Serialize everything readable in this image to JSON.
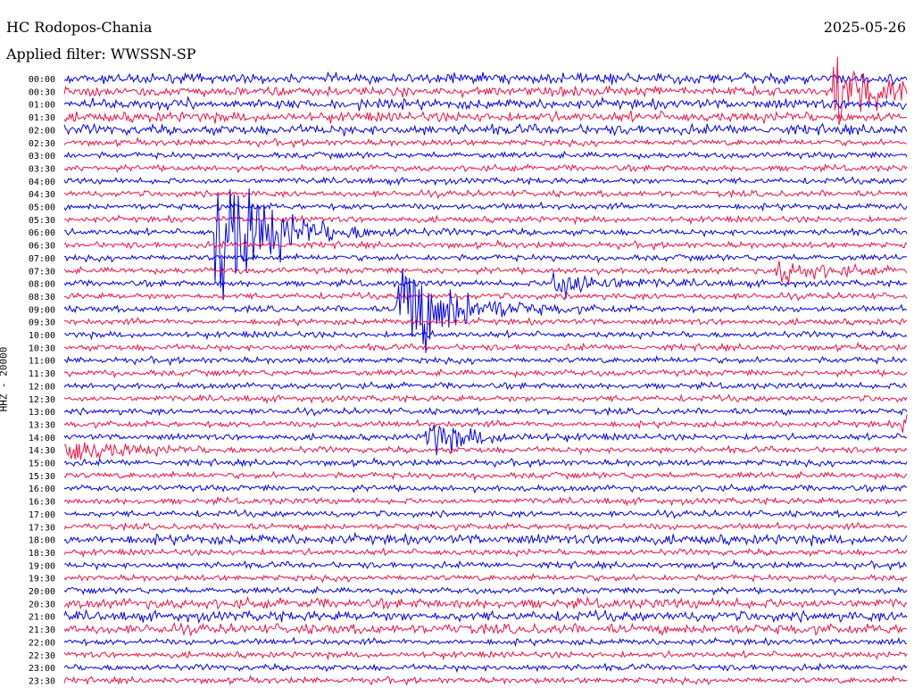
{
  "header": {
    "station": "HC Rodopos-Chania",
    "date": "2025-05-26",
    "filter": "Applied filter: WWSSN-SP",
    "channel": "HHZ - 20000"
  },
  "colors": {
    "even_trace": "#0000ee",
    "odd_trace": "#ee1144",
    "background": "#ffffff",
    "text": "#000000"
  },
  "chart_data": {
    "type": "seismogram-helicorder",
    "title": "HC Rodopos-Chania",
    "subtitle": "Applied filter: WWSSN-SP",
    "date": "2025-05-26",
    "ylabel": "HHZ - 20000",
    "row_interval_minutes": 30,
    "row_labels": [
      "00:00",
      "00:30",
      "01:00",
      "01:30",
      "02:00",
      "02:30",
      "03:00",
      "03:30",
      "04:00",
      "04:30",
      "05:00",
      "05:30",
      "06:00",
      "06:30",
      "07:00",
      "07:30",
      "08:00",
      "08:30",
      "09:00",
      "09:30",
      "10:00",
      "10:30",
      "11:00",
      "11:30",
      "12:00",
      "12:30",
      "13:00",
      "13:30",
      "14:00",
      "14:30",
      "15:00",
      "15:30",
      "16:00",
      "16:30",
      "17:00",
      "17:30",
      "18:00",
      "18:30",
      "19:00",
      "19:30",
      "20:00",
      "20:30",
      "21:00",
      "21:30",
      "22:00",
      "22:30",
      "23:00",
      "23:30"
    ],
    "trace_colors": [
      "#0000ee",
      "#ee1144"
    ],
    "events": [
      {
        "row": 12,
        "minute": 5.5,
        "amplitude": 8.0
      },
      {
        "row": 18,
        "minute": 12.0,
        "amplitude": 6.0
      },
      {
        "row": 16,
        "minute": 17.5,
        "amplitude": 1.5
      },
      {
        "row": 15,
        "minute": 25.5,
        "amplitude": 1.0
      },
      {
        "row": 1,
        "minute": 27.5,
        "amplitude": 3.0
      },
      {
        "row": 28,
        "minute": 13.0,
        "amplitude": 1.5
      },
      {
        "row": 29,
        "minute": 0.0,
        "amplitude": 1.5
      },
      {
        "row": 27,
        "minute": 30.0,
        "amplitude": 1.2
      }
    ],
    "noisy_rows": [
      0,
      1,
      2,
      3,
      4,
      36,
      41,
      42,
      43
    ]
  }
}
